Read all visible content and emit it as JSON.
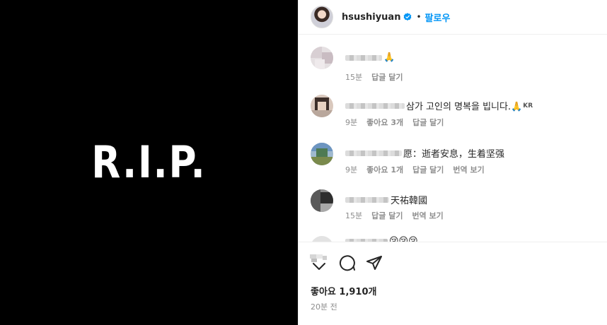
{
  "media": {
    "text": "R.I.P."
  },
  "header": {
    "username": "hsushiyuan",
    "dot": "•",
    "follow_label": "팔로우"
  },
  "comments": [
    {
      "text": "🙏",
      "meta": [
        "15분",
        "답글 달기"
      ]
    },
    {
      "text": "삼가 고인의 명복을 빕니다.🙏",
      "badge": "KR",
      "meta": [
        "9분",
        "좋아요 3개",
        "답글 달기"
      ]
    },
    {
      "text": "愿：逝者安息，生着坚强",
      "meta": [
        "9분",
        "좋아요 1개",
        "답글 달기",
        "번역 보기"
      ]
    },
    {
      "text": "天祐韓國",
      "meta": [
        "15분",
        "답글 달기",
        "번역 보기"
      ]
    },
    {
      "text": "😢😢😢",
      "meta": []
    }
  ],
  "footer": {
    "likes": "좋아요 1,910개",
    "time": "20분 전"
  },
  "icons": {
    "verified": "verified-badge-icon",
    "comment": "comment-bubble-icon",
    "share": "paper-plane-share-icon",
    "like_stack": "liked-by-avatars-icon"
  },
  "colors": {
    "accent": "#0095f6",
    "muted": "#8e8e8e",
    "text": "#262626"
  }
}
